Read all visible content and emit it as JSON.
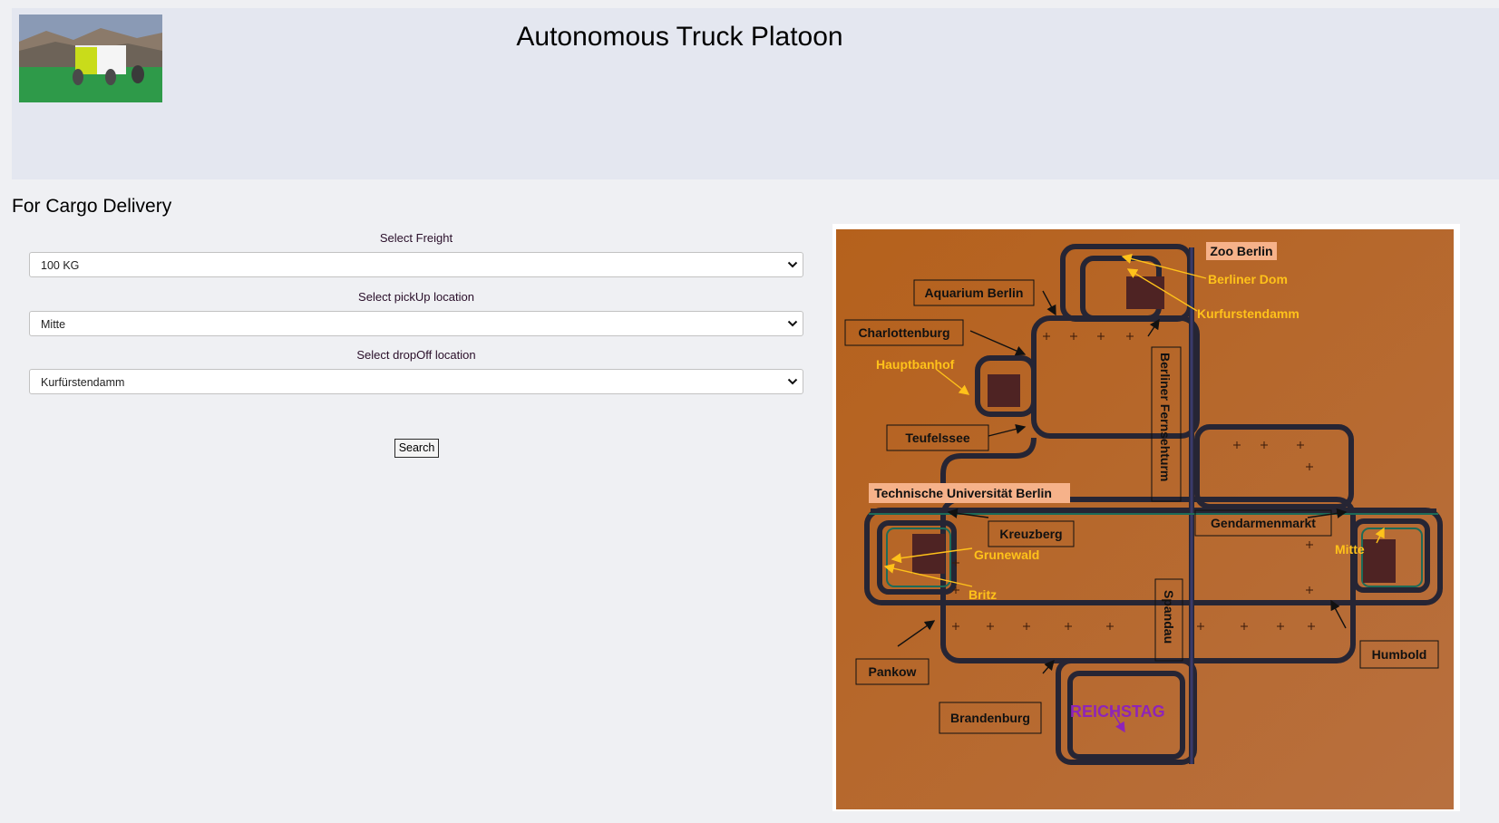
{
  "header": {
    "title": "Autonomous Truck Platoon",
    "logo_icon": "truck-illustration-icon"
  },
  "form": {
    "heading": "For Cargo Delivery",
    "freight_label": "Select Freight",
    "freight_value": "100 KG",
    "pickup_label": "Select pickUp location",
    "pickup_value": "Mitte",
    "dropoff_label": "Select dropOff location",
    "dropoff_value": "Kurfürstendamm",
    "search_label": "Search"
  },
  "map": {
    "labels": {
      "zoo_berlin": "Zoo Berlin",
      "aquarium_berlin": "Aquarium Berlin",
      "charlottenburg": "Charlottenburg",
      "teufelssee": "Teufelssee",
      "technische_universitaet": "Technische Universität Berlin",
      "kreuzberg": "Kreuzberg",
      "gendarmenmarkt": "Gendarmenmarkt",
      "pankow": "Pankow",
      "brandenburg": "Brandenburg",
      "humbold": "Humbold",
      "spandau": "Spandau",
      "berliner_fernsehturm": "Berliner Fernsehturm",
      "berliner_dom": "Berliner Dom",
      "kurfurstendamm": "Kurfurstendamm",
      "hauptbanhof": "Hauptbanhof",
      "grunewald": "Grunewald",
      "britz": "Britz",
      "mitte": "Mitte",
      "reichstag": "REICHSTAG"
    },
    "colors": {
      "ground": "#b8651f",
      "track": "#262534",
      "label_yellow": "#ffc21a",
      "reichstag": "#8e24b8",
      "highlight": "#f6b28a",
      "station": "#4e2323"
    }
  }
}
